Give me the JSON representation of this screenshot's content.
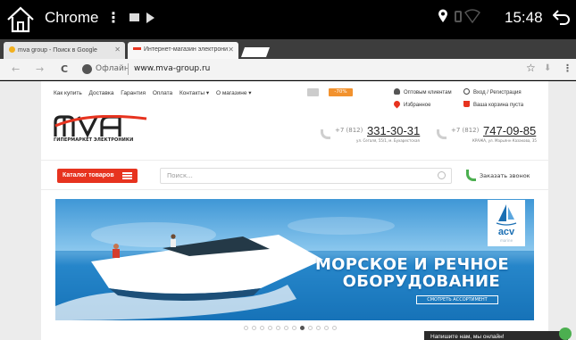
{
  "statusbar": {
    "app_name": "Chrome",
    "menu_label": "⋮",
    "time": "15:48",
    "icons": [
      "home-icon",
      "media-icon",
      "play-icon",
      "location-icon",
      "sim-icon",
      "wifi-icon",
      "back-icon"
    ]
  },
  "tabs": [
    {
      "title": "mva group - Поиск в Google",
      "close": "✕",
      "active": false
    },
    {
      "title": "Интернет-магазин электрони",
      "close": "✕",
      "active": true
    }
  ],
  "address_bar": {
    "back": "←",
    "forward": "→",
    "reload": "C",
    "status": "Офлайн",
    "url": "www.mva-group.ru",
    "star": "☆",
    "download": "⬇",
    "menu": "⋮"
  },
  "site": {
    "top_nav": [
      "Как купить",
      "Доставка",
      "Гарантия",
      "Оплата",
      "Контакты ▾",
      "О магазине ▾"
    ],
    "promo_badge": "-70%",
    "utility": {
      "wholesale": "Оптовым клиентам",
      "login": "Вход / Регистрация",
      "favorites": "Избранное",
      "cart": "Ваша корзина пуста"
    },
    "logo_text": "mva",
    "logo_tagline": "ГИПЕРМАРКЕТ ЭЛЕКТРОНИКИ",
    "phones": [
      {
        "prefix": "+7 (812)",
        "number": "331-30-31",
        "address": "ул. Сегаля, 55/1, м. Бухарестская"
      },
      {
        "prefix": "+7 (812)",
        "number": "747-09-85",
        "address": "КРАЖА, ул. Марьянн Казакова, 35"
      }
    ],
    "catalog_button": "Каталог товаров",
    "search_placeholder": "Поиск...",
    "callback": "Заказать звонок",
    "banner": {
      "line1": "МОРСКОЕ И РЕЧНОЕ",
      "line2": "ОБОРУДОВАНИЕ",
      "button": "СМОТРЕТЬ АССОРТИМЕНТ",
      "brand": "acv",
      "brand_sub": "marine"
    },
    "slider": {
      "count": 12,
      "active_index": 7
    },
    "chat": "Напишите нам, мы онлайн!"
  },
  "colors": {
    "accent_red": "#e7331f",
    "promo_orange": "#f2922e",
    "chat_green": "#4caf50",
    "banner_sky": "#62b6e6"
  }
}
